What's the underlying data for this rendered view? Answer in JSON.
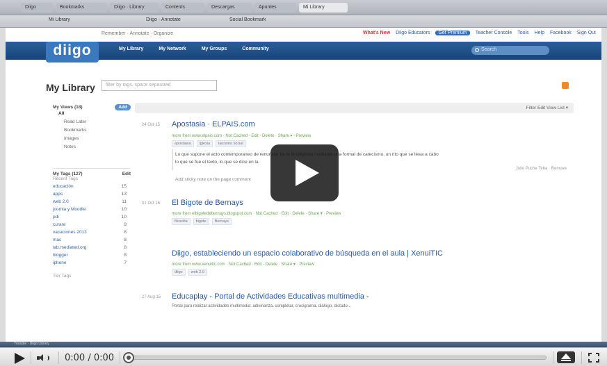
{
  "browser": {
    "tabs": [
      "Diigo",
      "Bookmarks",
      "Diigo · Library",
      "Contents",
      "Descargas",
      "Apuntes",
      "Mi Library"
    ],
    "bookmarks": [
      "Mi Library",
      "Diigo · Annotate",
      "Social Bookmark"
    ]
  },
  "page": {
    "tagline": "Remember · Annotate · Organize",
    "top_links": [
      "What's New",
      "Diigo Educators",
      "Get Premium",
      "Teacher Console",
      "Tools",
      "Help",
      "Facebook",
      "Sign Out"
    ],
    "logo": "diigo",
    "nav": [
      "My Library",
      "My Network",
      "My Groups",
      "Community"
    ],
    "search_placeholder": "Search",
    "library_title": "My Library",
    "filter_placeholder": "filter by tags, space separated"
  },
  "sidebar": {
    "views_label": "My Views (18)",
    "add_button": "Add",
    "views": [
      "All",
      "Read Later",
      "Bookmarks",
      "Images",
      "Notes"
    ],
    "tags_label": "My Tags (127)",
    "edit_label": "Edit",
    "recent_label": "Recent Tags",
    "tags": [
      {
        "name": "educación",
        "count": "15"
      },
      {
        "name": "apps",
        "count": "13"
      },
      {
        "name": "web 2.0",
        "count": "11"
      },
      {
        "name": "joomla y Moodle",
        "count": "10"
      },
      {
        "name": "pdi",
        "count": "10"
      },
      {
        "name": "curare",
        "count": "9"
      },
      {
        "name": "vacaciones 2013",
        "count": "8"
      },
      {
        "name": "mac",
        "count": "8"
      },
      {
        "name": "lab.mediated.org",
        "count": "8"
      },
      {
        "name": "blogger",
        "count": "8"
      },
      {
        "name": "iphone",
        "count": "7"
      }
    ],
    "tier_label": "Tier Tags"
  },
  "main": {
    "toolbar": "Filter  Edit    View  List ▾",
    "entries": [
      {
        "date": "24 Oct 15",
        "title": "Apostasia · ELPAIS.com",
        "meta": "more from www.elpais.com · Not Cached · Edit · Delete · Share ▾ · Preview",
        "chips": [
          "apostasia",
          "iglesia",
          "laicismo social"
        ],
        "note": "Lo que supone el acto contemporaneo de renunciar de la fe religiosa mediante una formal de catecismo, un rito que se lleva a cabo",
        "note2": "lo que se fue el texto, lo que se dice en la",
        "note_meta": "Julio Puche Teba · Remove",
        "extra": "Add sticky note on the page comment"
      },
      {
        "date": "01 Oct 15",
        "title": "El Bigote de Bernays",
        "meta": "more from elbigotedebernays.blogspot.com · Not Cached · Edit · Delete · Share ▾ · Preview",
        "chips": [
          "filosofia",
          "bigote",
          "Bernays"
        ]
      },
      {
        "date": "",
        "title": "Diigo, estableciendo un espacio colaborativo de búsqueda en el aula | XenuiTIC",
        "meta": "more from www.xenuitic.com · Not Cached · Edit · Delete · Share ▾ · Preview",
        "chips": [
          "diigo",
          "web 2.0"
        ]
      },
      {
        "date": "27 Aug 15",
        "title": "Educaplay - Portal de Actividades Educativas multimedia -",
        "meta": "Portal para realizar actividades multimedia: adivinanza, completar, crucigrama, diálogo, dictado...",
        "chips": []
      }
    ]
  },
  "taskbar": "Youtube · Diigo Library",
  "player": {
    "time": "0:00 / 0:00",
    "progress": 0
  }
}
